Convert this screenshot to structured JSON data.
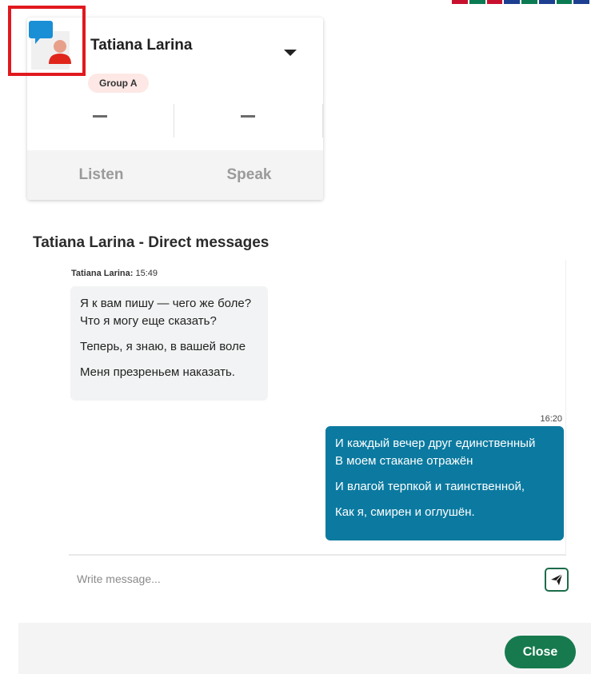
{
  "header": {
    "stripe_colors": [
      "#c8102e",
      "#0a7a52",
      "#c8102e",
      "#1d3f91",
      "#0a7a52",
      "#1d3f91",
      "#0a7a52",
      "#1d3f91"
    ]
  },
  "user_card": {
    "name": "Tatiana Larina",
    "group_badge": "Group A",
    "stat_left": "—",
    "stat_right": "—",
    "listen_label": "Listen",
    "speak_label": "Speak",
    "icons": [
      "chat-bubble-icon",
      "person-icon",
      "caret-down-icon"
    ],
    "colors": {
      "bubble": "#1a8fd6",
      "person_head": "#e8a08a",
      "person_body": "#e0251b",
      "highlight_border": "#e0191e"
    }
  },
  "direct_messages": {
    "title": "Tatiana Larina - Direct messages",
    "incoming": {
      "sender": "Tatiana Larina:",
      "time": "15:49",
      "paragraphs": [
        "Я к вам пишу — чего же боле?\nЧто я могу еще сказать?",
        "Теперь, я знаю, в вашей воле",
        "Меня презреньем наказать."
      ]
    },
    "outgoing": {
      "time": "16:20",
      "paragraphs": [
        "И каждый вечер друг единственный\nВ моем стакане отражён",
        "И влагой терпкой и таинственной,",
        "Как я, смирен и оглушён."
      ]
    },
    "composer": {
      "placeholder": "Write message...",
      "value": ""
    },
    "colors": {
      "incoming_bg": "#f2f3f4",
      "outgoing_bg": "#0c7aa0"
    }
  },
  "footer": {
    "close_label": "Close",
    "close_color": "#177a4e"
  }
}
